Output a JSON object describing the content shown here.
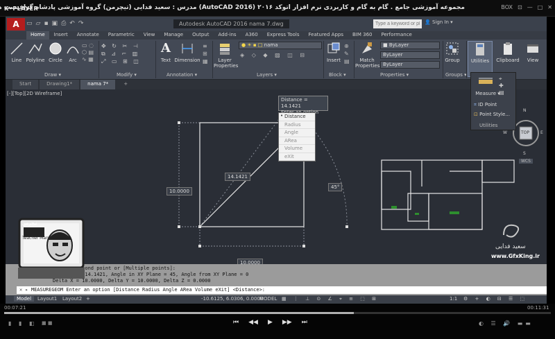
{
  "player": {
    "logo": "K•PLAYER",
    "title": "مجموعه آموزشی جامع . گام به گام و کاربردی نرم افزار اتوکد ۲۰۱۶ (AutoCAD 2016) مدرس : سعید فدایی (تیچرمن) گروه آموزشی پادشاه گرافیست ها",
    "ctrl_box": "BOX",
    "time_current": "00:07:21",
    "time_total": "00:11:31",
    "progress": 0.64,
    "btn_prev": "⏮",
    "btn_rew": "◀◀",
    "btn_play": "▶",
    "btn_fwd": "▶▶",
    "btn_next": "⏭"
  },
  "acad": {
    "logo": "A",
    "window_title": "Autodesk AutoCAD 2016   nama 7.dwg",
    "search_placeholder": "Type a keyword or phrase",
    "sign_in": "Sign In",
    "tabs": [
      "Home",
      "Insert",
      "Annotate",
      "Parametric",
      "View",
      "Manage",
      "Output",
      "Add-ins",
      "A360",
      "Express Tools",
      "Featured Apps",
      "BIM 360",
      "Performance"
    ],
    "ribbon": {
      "tools": {
        "line": "Line",
        "polyline": "Polyline",
        "circle": "Circle",
        "arc": "Arc",
        "text": "Text",
        "dimension": "Dimension",
        "layer_properties": "Layer Properties",
        "insert": "Insert",
        "match_properties": "Match Properties",
        "group": "Group",
        "utilities": "Utilities",
        "clipboard": "Clipboard",
        "view": "View"
      },
      "groups": {
        "draw": "Draw ▾",
        "modify": "Modify ▾",
        "annotation": "Annotation ▾",
        "layers": "Layers ▾",
        "block": "Block ▾",
        "properties": "Properties ▾",
        "groups": "Groups ▾"
      },
      "layer_combo": "nama",
      "bylayer_1": "ByLayer",
      "bylayer_2": "ByLayer",
      "bylayer_3": "ByLayer"
    },
    "file_tabs": [
      "Start",
      "Drawing1*",
      "nama 7*"
    ],
    "viewport_label": "[-][Top][2D Wireframe]",
    "dims": {
      "diag": "14.1421",
      "side": "10.0000",
      "bottom": "10.0000",
      "angle": "45°"
    },
    "tooltip": {
      "line1": "Distance = 14.1421",
      "line2": "Enter an option"
    },
    "options": [
      "Distance",
      "Radius",
      "Angle",
      "ARea",
      "Volume",
      "eXit"
    ],
    "utilities_panel": {
      "measure": "Measure",
      "id_point": "ID Point",
      "point_style": "Point Style...",
      "title": "Utilities"
    },
    "compass": {
      "n": "N",
      "s": "S",
      "e": "E",
      "w": "W",
      "top": "TOP",
      "wcs": "WCS"
    },
    "command_history": [
      "Specify second point or [Multiple points]:",
      "Distance = 14.1421,  Angle in XY Plane = 45,  Angle from XY Plane = 0",
      "Delta X = 10.0000,  Delta Y = 10.0000,   Delta Z = 0.0000"
    ],
    "command_input": "MEASUREGEOM Enter an option [Distance Radius Angle ARea Volume eXit] <Distance>:",
    "status": {
      "model_tab": "Model",
      "layout1": "Layout1",
      "layout2": "Layout2",
      "coords": "-10.6125, 6.0306, 0.0000",
      "model_btn": "MODEL",
      "scale": "1:1"
    }
  },
  "watermark": {
    "name": "سعید فدایی",
    "site": "www.GfxKing.ir"
  },
  "avatar": {
    "line1": "تیچرمن",
    "line2": "Teacher Man"
  }
}
